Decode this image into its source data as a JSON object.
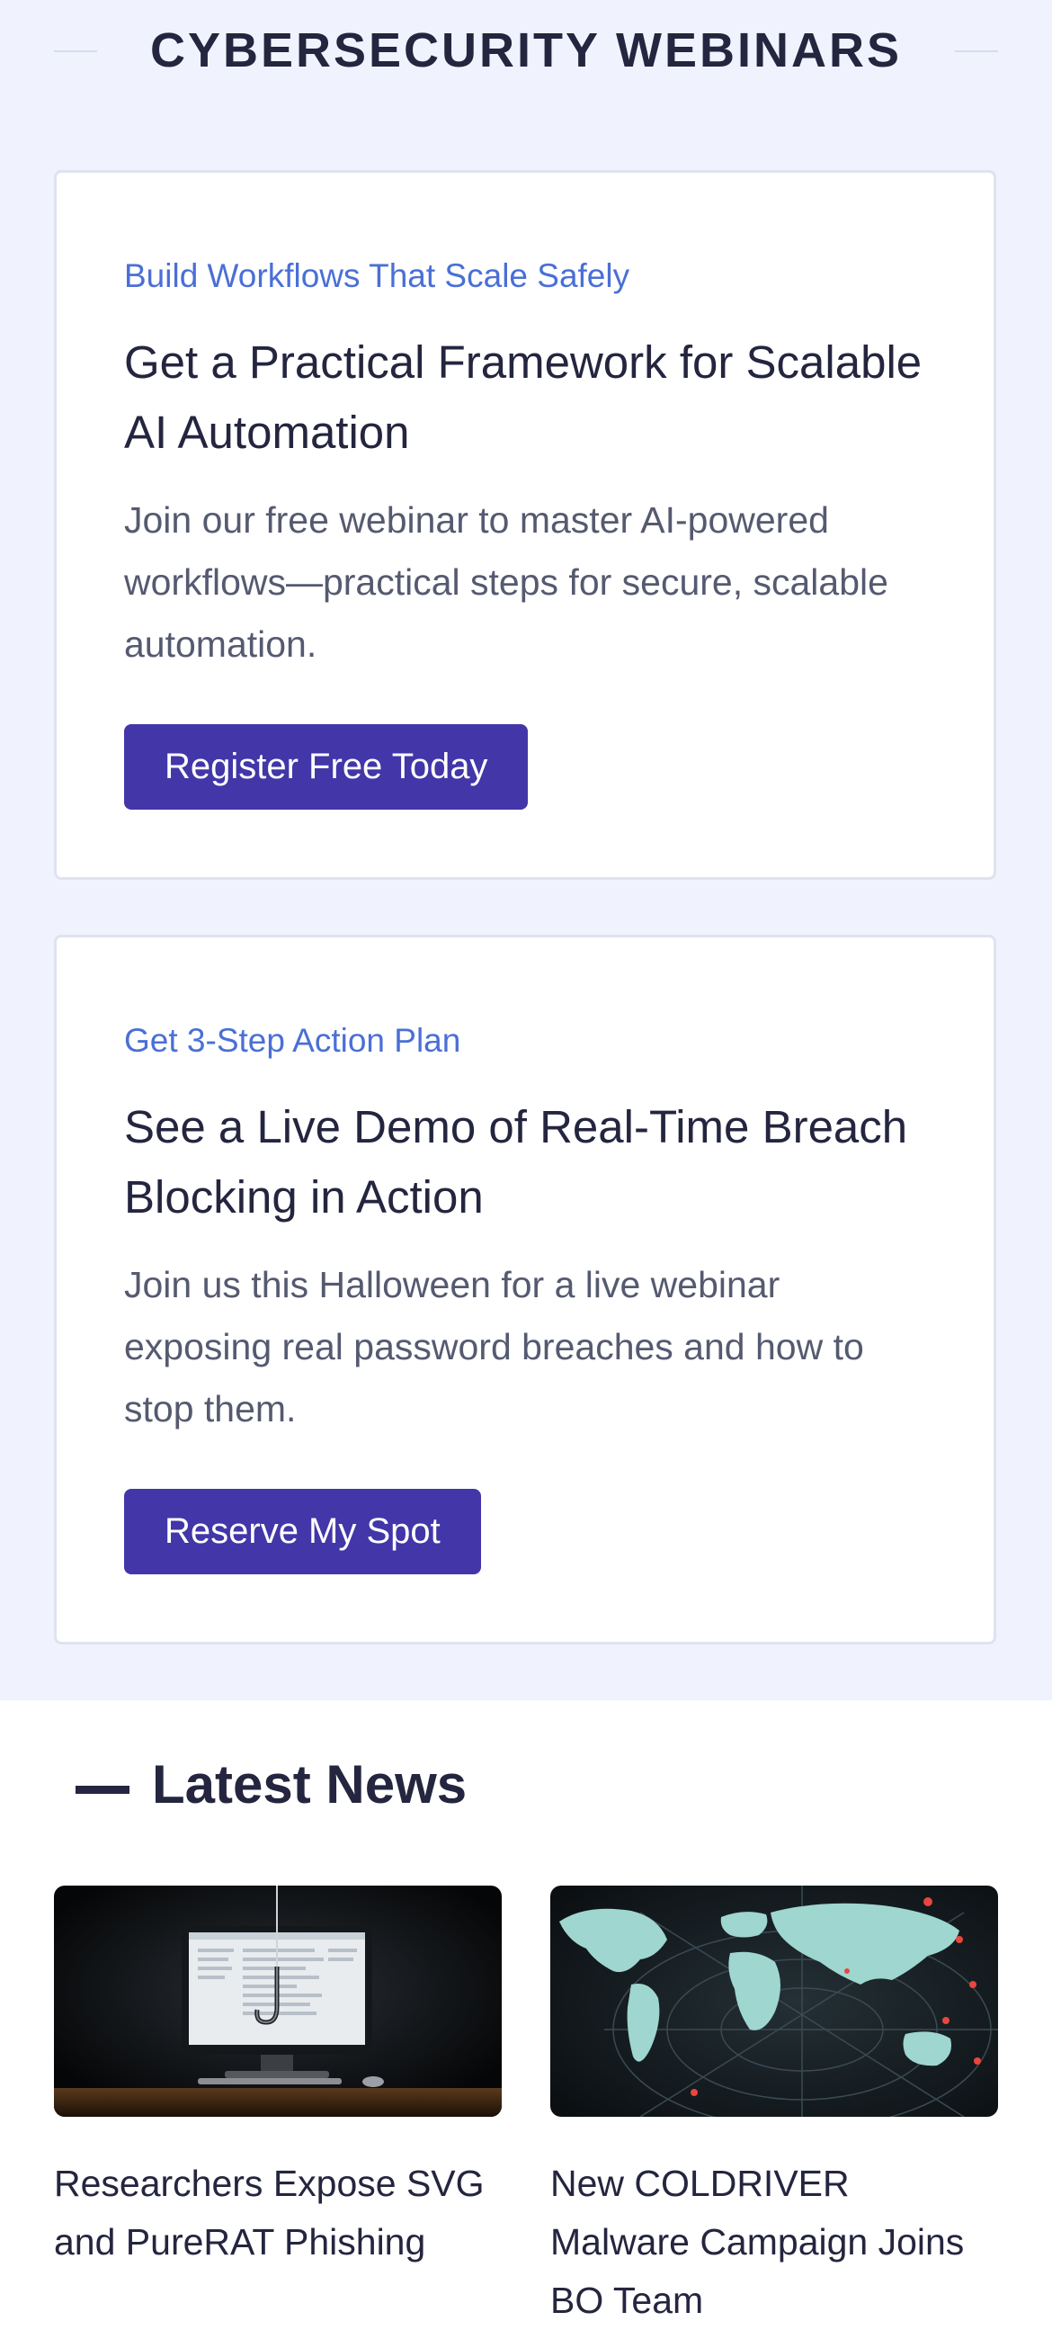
{
  "webinars": {
    "heading": "CYBERSECURITY WEBINARS",
    "cards": [
      {
        "eyebrow": "Build Workflows That Scale Safely",
        "title": "Get a Practical Framework for Scalable AI Automation",
        "description": "Join our free webinar to master AI-powered workflows—practical steps for secure, scalable automation.",
        "button": "Register Free Today"
      },
      {
        "eyebrow": "Get 3-Step Action Plan",
        "title": "See a Live Demo of Real-Time Breach Blocking in Action",
        "description": "Join us this Halloween for a live webinar exposing real password breaches and how to stop them.",
        "button": "Reserve My Spot"
      }
    ]
  },
  "news": {
    "heading": "Latest News",
    "items": [
      {
        "title": "Researchers Expose SVG and PureRAT Phishing",
        "image": "phishing-hook-computer"
      },
      {
        "title": "New COLDRIVER Malware Campaign Joins BO Team",
        "image": "world-map-radar"
      }
    ]
  },
  "colors": {
    "accent": "#4236a8",
    "eyebrow": "#4a6fd6",
    "heading": "#24253f",
    "section_bg": "#f0f3fe"
  }
}
